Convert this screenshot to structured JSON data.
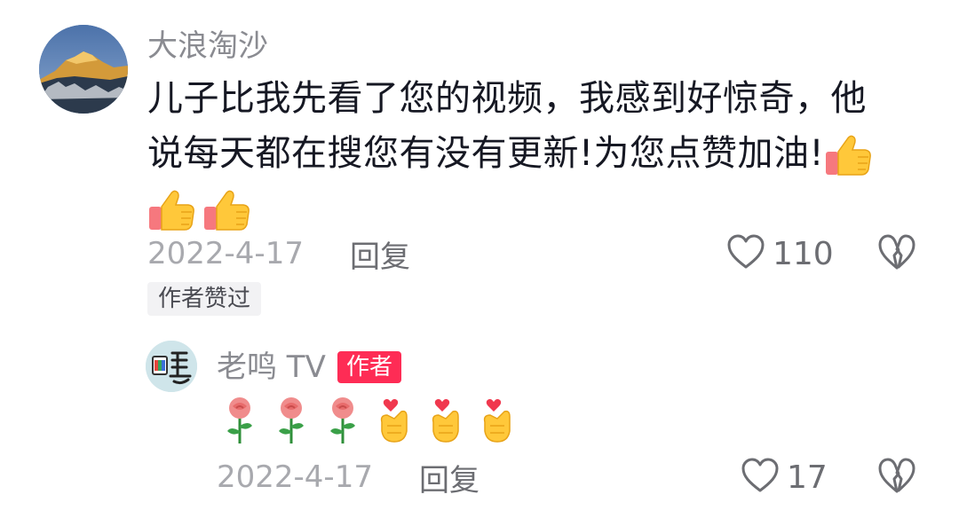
{
  "comment": {
    "username": "大浪淘沙",
    "line1": "儿子比我先看了您的视频，我感到好惊奇，他",
    "line2": "说每天都在搜您有没有更新!为您点赞加油!",
    "date": "2022-4-17",
    "reply_label": "回复",
    "like_count": "110",
    "author_liked_badge": "作者赞过",
    "emojis": [
      "thumbs-up",
      "thumbs-up",
      "thumbs-up"
    ]
  },
  "reply": {
    "username": "老鸣 TV",
    "author_tag": "作者",
    "emojis": [
      "rose",
      "rose",
      "rose",
      "finger-heart",
      "finger-heart",
      "finger-heart"
    ],
    "date": "2022-4-17",
    "reply_label": "回复",
    "like_count": "17"
  },
  "colors": {
    "text": "#161823",
    "secondary": "#8a8b91",
    "author_tag": "#fe2c55",
    "badge_bg": "#f2f2f4"
  }
}
